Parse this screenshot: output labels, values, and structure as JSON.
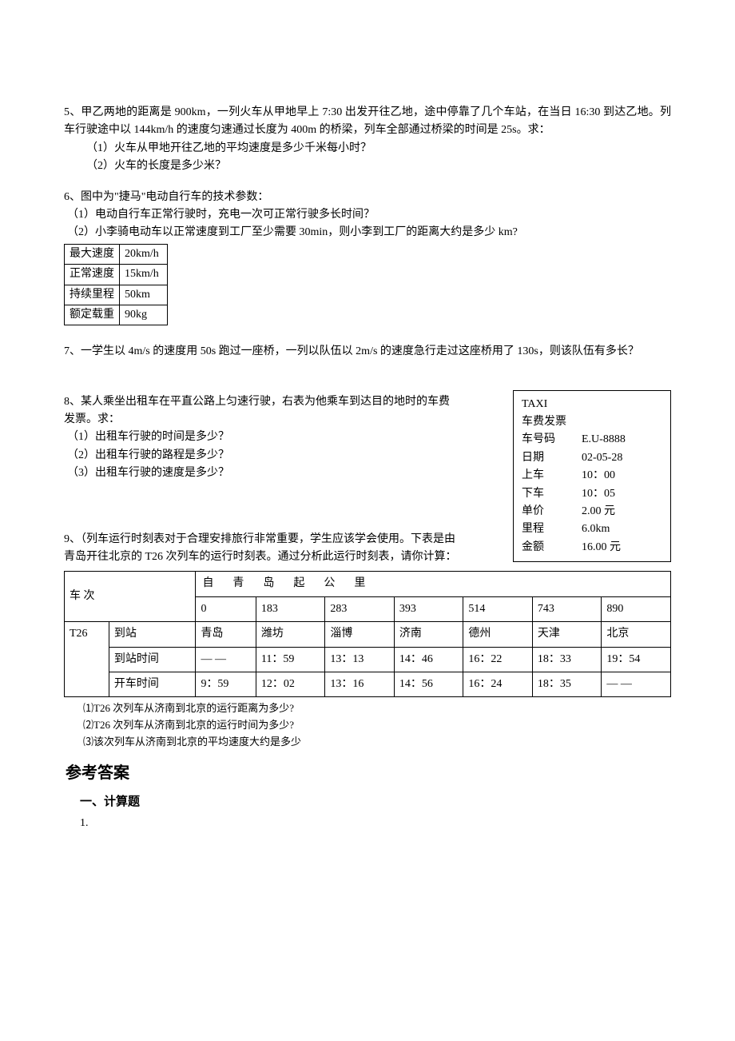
{
  "q5": {
    "text": "5、甲乙两地的距离是 900km，一列火车从甲地早上 7:30 出发开往乙地，途中停靠了几个车站，在当日 16:30 到达乙地。列车行驶途中以 144km/h 的速度匀速通过长度为 400m 的桥梁，列车全部通过桥梁的时间是 25s。求：",
    "sub1": "（1）火车从甲地开往乙地的平均速度是多少千米每小时？",
    "sub2": "（2）火车的长度是多少米？"
  },
  "q6": {
    "text": "6、图中为\"捷马\"电动自行车的技术参数：",
    "sub1": "（1）电动自行车正常行驶时，充电一次可正常行驶多长时间？",
    "sub2": "（2）小李骑电动车以正常速度到工厂至少需要 30min，则小李到工厂的距离大约是多少 km?",
    "table": {
      "r1c1": "最大速度",
      "r1c2": "20km/h",
      "r2c1": "正常速度",
      "r2c2": "15km/h",
      "r3c1": "持续里程",
      "r3c2": "50km",
      "r4c1": "额定载重",
      "r4c2": "90kg"
    }
  },
  "q7": {
    "text": "7、一学生以 4m/s 的速度用 50s 跑过一座桥，一列以队伍以 2m/s 的速度急行走过这座桥用了 130s，则该队伍有多长？"
  },
  "q8": {
    "intro1": "8、某人乘坐出租车在平直公路上匀速行驶，右表为他乘车到达目的地时的车费",
    "intro2": "发票。求：",
    "sub1": "（1）出租车行驶的时间是多少？",
    "sub2": "（2）出租车行驶的路程是多少？",
    "sub3": "（3）出租车行驶的速度是多少？",
    "receipt": {
      "title": "TAXI",
      "subtitle": "车费发票",
      "rows": [
        {
          "label": "车号码",
          "value": "E.U-8888"
        },
        {
          "label": "日期",
          "value": "02-05-28"
        },
        {
          "label": "上车",
          "value": "10：00"
        },
        {
          "label": "下车",
          "value": "10：05"
        },
        {
          "label": "单价",
          "value": "2.00 元"
        },
        {
          "label": "里程",
          "value": "6.0km"
        },
        {
          "label": "金额",
          "value": "16.00 元"
        }
      ]
    }
  },
  "q9": {
    "intro1": "9、（列车运行时刻表对于合理安排旅行非常重要，学生应该学会使用。下表是由",
    "intro2": "青岛开往北京的 T26 次列车的运行时刻表。通过分析此运行时刻表，请你计算：",
    "header_label": "车 次",
    "header_text": "自青岛起公里",
    "km": [
      "0",
      "183",
      "283",
      "393",
      "514",
      "743",
      "890"
    ],
    "train_no": "T26",
    "row_labels": [
      "到站",
      "到站时间",
      "开车时间"
    ],
    "stations": [
      "青岛",
      "潍坊",
      "淄博",
      "济南",
      "德州",
      "天津",
      "北京"
    ],
    "arrive": [
      "— —",
      "11：59",
      "13：13",
      "14：46",
      "16：22",
      "18：33",
      "19：54"
    ],
    "depart": [
      "9：59",
      "12：02",
      "13：16",
      "14：56",
      "16：24",
      "18：35",
      "— —"
    ],
    "sub1": "⑴T26 次列车从济南到北京的运行距离为多少?",
    "sub2": "⑵T26 次列车从济南到北京的运行时间为多少?",
    "sub3": "⑶该次列车从济南到北京的平均速度大约是多少"
  },
  "answers": {
    "title": "参考答案",
    "section": "一、计算题",
    "num": "1."
  }
}
